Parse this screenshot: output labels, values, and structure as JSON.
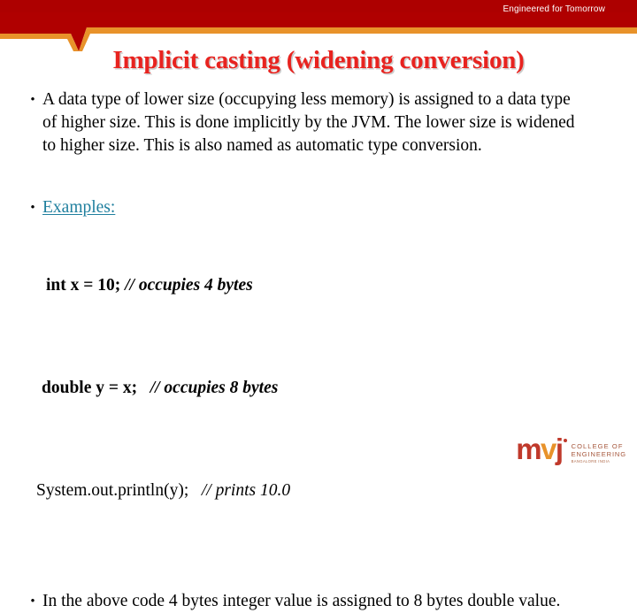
{
  "slide": {
    "tagline": "Engineered for Tomorrow",
    "title": "Implicit casting (widening conversion)"
  },
  "colors": {
    "header_red": "#b00000",
    "header_red_dark": "#9e0000",
    "accent_orange": "#e8922a",
    "title_red": "#e8231f",
    "examples_teal": "#1f7f9e",
    "body_black": "#000000",
    "logo_crimson": "#c0392b",
    "logo_orange": "#e8922a",
    "logo_words": "#a5553a"
  },
  "bullets": {
    "marker": "•",
    "first": "A data type of lower size (occupying less memory) is assigned to a data type of higher size. This is done implicitly by the JVM. The lower size is widened to higher size. This is also named as automatic type conversion.",
    "examples_label": "Examples:",
    "third": "In the above code 4 bytes integer value is assigned to 8 bytes double value."
  },
  "code": {
    "line1_stmt": "int x = 10;",
    "line1_comment": " // occupies 4 bytes",
    "line2_stmt": "double y = x;",
    "line2_comment": "   // occupies 8 bytes",
    "line3_stmt": "System.out.println(y);",
    "line3_comment": "   // prints 10.0"
  },
  "logo": {
    "mark_m": "m",
    "mark_v": "v",
    "mark_j": "j",
    "line1": "COLLEGE OF",
    "line2": "ENGINEERING",
    "line3": "BANGALORE INDIA"
  }
}
